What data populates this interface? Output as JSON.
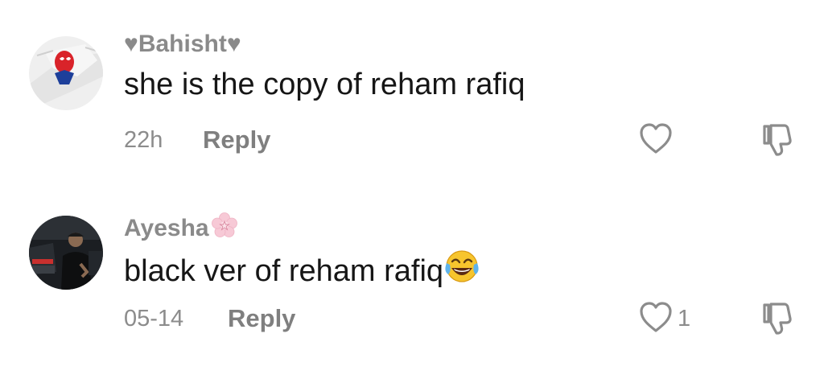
{
  "comments": [
    {
      "username": "♥Bahisht♥",
      "text": "she is the copy of reham rafiq",
      "timestamp": "22h",
      "reply_label": "Reply",
      "like_count": "",
      "avatar_icon": "spiderman-avatar"
    },
    {
      "username": "Ayesha",
      "username_badge_icon": "cherry-blossom-icon",
      "text": "black ver of reham rafiq",
      "text_emoji_icon": "tears-of-joy-emoji",
      "timestamp": "05-14",
      "reply_label": "Reply",
      "like_count": "1",
      "avatar_icon": "man-with-car-avatar"
    }
  ],
  "colors": {
    "username": "#8a8a8a",
    "body_text": "#161616",
    "meta_text": "#8c8c8c",
    "icon_stroke": "#8c8c8c",
    "blossom": "#f7c9d6"
  }
}
